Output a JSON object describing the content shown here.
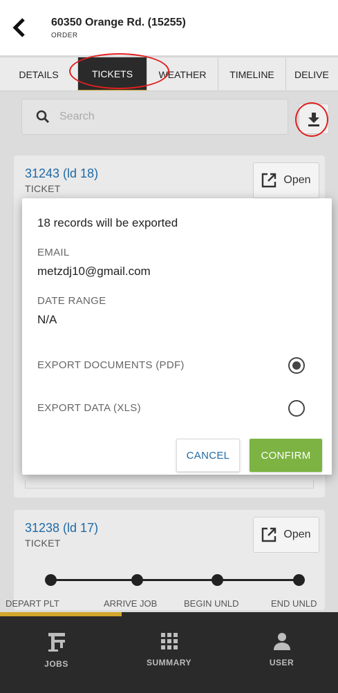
{
  "header": {
    "title": "60350 Orange Rd. (15255)",
    "subtitle": "ORDER"
  },
  "tabs": [
    {
      "label": "DETAILS"
    },
    {
      "label": "TICKETS",
      "active": true
    },
    {
      "label": "WEATHER"
    },
    {
      "label": "TIMELINE"
    },
    {
      "label": "DELIVE"
    }
  ],
  "search": {
    "placeholder": "Search"
  },
  "tickets": [
    {
      "number": "31243 (ld 18)",
      "label": "TICKET",
      "open_label": "Open"
    },
    {
      "number": "31238 (ld 17)",
      "label": "TICKET",
      "open_label": "Open"
    }
  ],
  "timeline": {
    "stages": [
      "DEPART PLT",
      "ARRIVE JOB",
      "BEGIN UNLD",
      "END UNLD"
    ],
    "progress_fraction": 0.36
  },
  "dialog": {
    "title": "18 records will be exported",
    "email_label": "EMAIL",
    "email_value": "metzdj10@gmail.com",
    "date_range_label": "DATE RANGE",
    "date_range_value": "N/A",
    "options": [
      {
        "label": "EXPORT DOCUMENTS (PDF)",
        "selected": true
      },
      {
        "label": "EXPORT DATA (XLS)",
        "selected": false
      }
    ],
    "cancel_label": "CANCEL",
    "confirm_label": "CONFIRM"
  },
  "bottom_nav": [
    {
      "label": "JOBS",
      "icon": "jobs-icon"
    },
    {
      "label": "SUMMARY",
      "icon": "grid-icon"
    },
    {
      "label": "USER",
      "icon": "user-icon"
    }
  ],
  "colors": {
    "link_blue": "#1f6aa6",
    "confirm_green": "#7cb342",
    "accent_gold": "#d4a72c",
    "annotation_red": "#e02020",
    "nav_dark": "#2a2a2a"
  }
}
